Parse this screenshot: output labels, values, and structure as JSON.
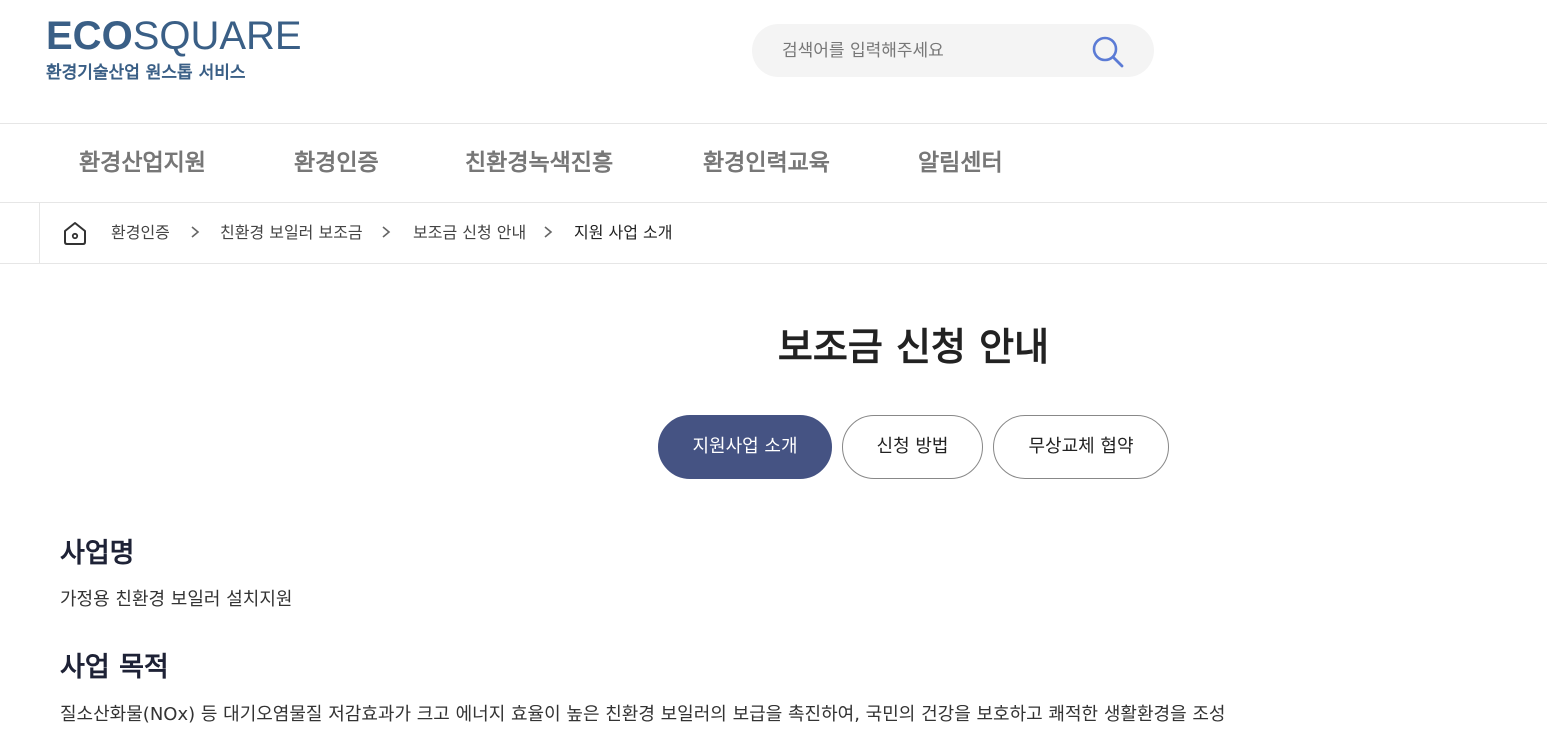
{
  "logo": {
    "bold": "ECO",
    "light": "SQUARE",
    "subtitle": "환경기술산업 원스톱 서비스"
  },
  "search": {
    "placeholder": "검색어를 입력해주세요",
    "value": "",
    "icon": "search-icon"
  },
  "nav": {
    "items": [
      "환경산업지원",
      "환경인증",
      "친환경녹색진흥",
      "환경인력교육",
      "알림센터"
    ]
  },
  "breadcrumb": {
    "home_icon": "home-icon",
    "items": [
      "환경인증",
      "친환경 보일러 보조금",
      "보조금 신청 안내",
      "지원 사업 소개"
    ]
  },
  "page": {
    "title": "보조금 신청 안내"
  },
  "tabs": [
    {
      "label": "지원사업 소개",
      "active": true
    },
    {
      "label": "신청 방법",
      "active": false
    },
    {
      "label": "무상교체 협약",
      "active": false
    }
  ],
  "sections": [
    {
      "title": "사업명",
      "text": "가정용 친환경 보일러 설치지원"
    },
    {
      "title": "사업 목적",
      "text": "질소산화물(NOx) 등 대기오염물질 저감효과가 크고 에너지 효율이 높은 친환경 보일러의 보급을 촉진하여, 국민의 건강을 보호하고 쾌적한 생활환경을 조성"
    }
  ],
  "colors": {
    "brand": "#3a5f86",
    "tab_active": "#455383",
    "search_icon": "#5b7bd5"
  }
}
